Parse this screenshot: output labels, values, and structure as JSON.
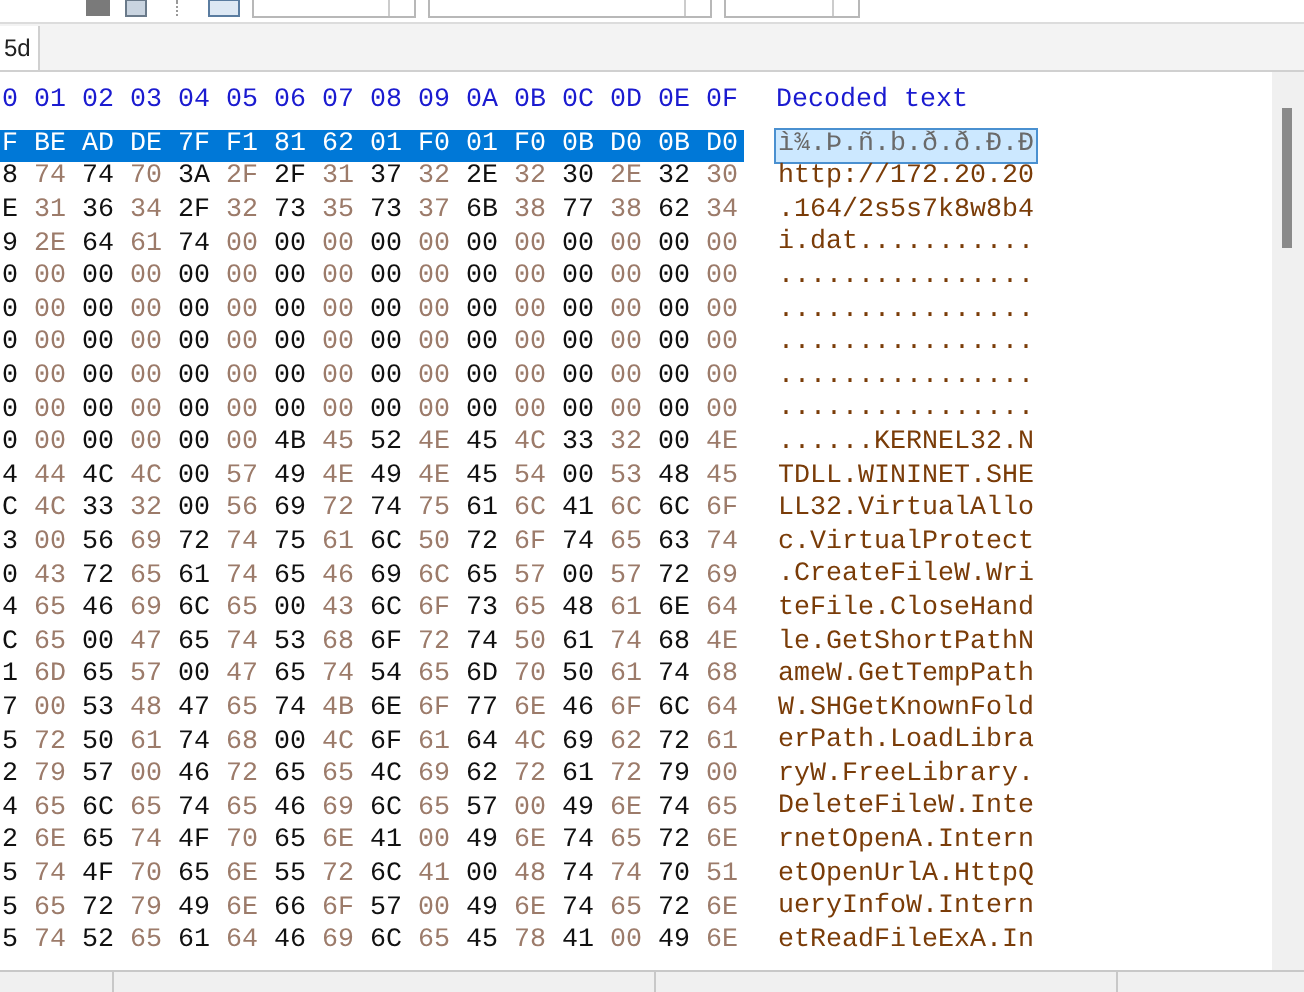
{
  "tabs": [
    {
      "label": "5d",
      "selected": true
    }
  ],
  "hex_header": {
    "offsets": [
      "0",
      "01",
      "02",
      "03",
      "04",
      "05",
      "06",
      "07",
      "08",
      "09",
      "0A",
      "0B",
      "0C",
      "0D",
      "0E",
      "0F"
    ],
    "decoded_label": "Decoded text"
  },
  "rows": [
    {
      "bytes": [
        "F",
        "BE",
        "AD",
        "DE",
        "7F",
        "F1",
        "81",
        "62",
        "01",
        "F0",
        "01",
        "F0",
        "0B",
        "D0",
        "0B",
        "D0"
      ],
      "decoded": "ì¾.Þ.ñ.b.ð.ð.Ð.Ð",
      "selected": true
    },
    {
      "bytes": [
        "8",
        "74",
        "74",
        "70",
        "3A",
        "2F",
        "2F",
        "31",
        "37",
        "32",
        "2E",
        "32",
        "30",
        "2E",
        "32",
        "30"
      ],
      "decoded": "http://172.20.20",
      "selected": false
    },
    {
      "bytes": [
        "E",
        "31",
        "36",
        "34",
        "2F",
        "32",
        "73",
        "35",
        "73",
        "37",
        "6B",
        "38",
        "77",
        "38",
        "62",
        "34"
      ],
      "decoded": ".164/2s5s7k8w8b4",
      "selected": false
    },
    {
      "bytes": [
        "9",
        "2E",
        "64",
        "61",
        "74",
        "00",
        "00",
        "00",
        "00",
        "00",
        "00",
        "00",
        "00",
        "00",
        "00",
        "00"
      ],
      "decoded": "i.dat...........",
      "selected": false
    },
    {
      "bytes": [
        "0",
        "00",
        "00",
        "00",
        "00",
        "00",
        "00",
        "00",
        "00",
        "00",
        "00",
        "00",
        "00",
        "00",
        "00",
        "00"
      ],
      "decoded": "................",
      "selected": false
    },
    {
      "bytes": [
        "0",
        "00",
        "00",
        "00",
        "00",
        "00",
        "00",
        "00",
        "00",
        "00",
        "00",
        "00",
        "00",
        "00",
        "00",
        "00"
      ],
      "decoded": "................",
      "selected": false
    },
    {
      "bytes": [
        "0",
        "00",
        "00",
        "00",
        "00",
        "00",
        "00",
        "00",
        "00",
        "00",
        "00",
        "00",
        "00",
        "00",
        "00",
        "00"
      ],
      "decoded": "................",
      "selected": false
    },
    {
      "bytes": [
        "0",
        "00",
        "00",
        "00",
        "00",
        "00",
        "00",
        "00",
        "00",
        "00",
        "00",
        "00",
        "00",
        "00",
        "00",
        "00"
      ],
      "decoded": "................",
      "selected": false
    },
    {
      "bytes": [
        "0",
        "00",
        "00",
        "00",
        "00",
        "00",
        "00",
        "00",
        "00",
        "00",
        "00",
        "00",
        "00",
        "00",
        "00",
        "00"
      ],
      "decoded": "................",
      "selected": false
    },
    {
      "bytes": [
        "0",
        "00",
        "00",
        "00",
        "00",
        "00",
        "4B",
        "45",
        "52",
        "4E",
        "45",
        "4C",
        "33",
        "32",
        "00",
        "4E"
      ],
      "decoded": "......KERNEL32.N",
      "selected": false
    },
    {
      "bytes": [
        "4",
        "44",
        "4C",
        "4C",
        "00",
        "57",
        "49",
        "4E",
        "49",
        "4E",
        "45",
        "54",
        "00",
        "53",
        "48",
        "45"
      ],
      "decoded": "TDLL.WININET.SHE",
      "selected": false
    },
    {
      "bytes": [
        "C",
        "4C",
        "33",
        "32",
        "00",
        "56",
        "69",
        "72",
        "74",
        "75",
        "61",
        "6C",
        "41",
        "6C",
        "6C",
        "6F"
      ],
      "decoded": "LL32.VirtualAllo",
      "selected": false
    },
    {
      "bytes": [
        "3",
        "00",
        "56",
        "69",
        "72",
        "74",
        "75",
        "61",
        "6C",
        "50",
        "72",
        "6F",
        "74",
        "65",
        "63",
        "74"
      ],
      "decoded": "c.VirtualProtect",
      "selected": false
    },
    {
      "bytes": [
        "0",
        "43",
        "72",
        "65",
        "61",
        "74",
        "65",
        "46",
        "69",
        "6C",
        "65",
        "57",
        "00",
        "57",
        "72",
        "69"
      ],
      "decoded": ".CreateFileW.Wri",
      "selected": false
    },
    {
      "bytes": [
        "4",
        "65",
        "46",
        "69",
        "6C",
        "65",
        "00",
        "43",
        "6C",
        "6F",
        "73",
        "65",
        "48",
        "61",
        "6E",
        "64"
      ],
      "decoded": "teFile.CloseHand",
      "selected": false
    },
    {
      "bytes": [
        "C",
        "65",
        "00",
        "47",
        "65",
        "74",
        "53",
        "68",
        "6F",
        "72",
        "74",
        "50",
        "61",
        "74",
        "68",
        "4E"
      ],
      "decoded": "le.GetShortPathN",
      "selected": false
    },
    {
      "bytes": [
        "1",
        "6D",
        "65",
        "57",
        "00",
        "47",
        "65",
        "74",
        "54",
        "65",
        "6D",
        "70",
        "50",
        "61",
        "74",
        "68"
      ],
      "decoded": "ameW.GetTempPath",
      "selected": false
    },
    {
      "bytes": [
        "7",
        "00",
        "53",
        "48",
        "47",
        "65",
        "74",
        "4B",
        "6E",
        "6F",
        "77",
        "6E",
        "46",
        "6F",
        "6C",
        "64"
      ],
      "decoded": "W.SHGetKnownFold",
      "selected": false
    },
    {
      "bytes": [
        "5",
        "72",
        "50",
        "61",
        "74",
        "68",
        "00",
        "4C",
        "6F",
        "61",
        "64",
        "4C",
        "69",
        "62",
        "72",
        "61"
      ],
      "decoded": "erPath.LoadLibra",
      "selected": false
    },
    {
      "bytes": [
        "2",
        "79",
        "57",
        "00",
        "46",
        "72",
        "65",
        "65",
        "4C",
        "69",
        "62",
        "72",
        "61",
        "72",
        "79",
        "00"
      ],
      "decoded": "ryW.FreeLibrary.",
      "selected": false
    },
    {
      "bytes": [
        "4",
        "65",
        "6C",
        "65",
        "74",
        "65",
        "46",
        "69",
        "6C",
        "65",
        "57",
        "00",
        "49",
        "6E",
        "74",
        "65"
      ],
      "decoded": "DeleteFileW.Inte",
      "selected": false
    },
    {
      "bytes": [
        "2",
        "6E",
        "65",
        "74",
        "4F",
        "70",
        "65",
        "6E",
        "41",
        "00",
        "49",
        "6E",
        "74",
        "65",
        "72",
        "6E"
      ],
      "decoded": "rnetOpenA.Intern",
      "selected": false
    },
    {
      "bytes": [
        "5",
        "74",
        "4F",
        "70",
        "65",
        "6E",
        "55",
        "72",
        "6C",
        "41",
        "00",
        "48",
        "74",
        "74",
        "70",
        "51"
      ],
      "decoded": "etOpenUrlA.HttpQ",
      "selected": false
    },
    {
      "bytes": [
        "5",
        "65",
        "72",
        "79",
        "49",
        "6E",
        "66",
        "6F",
        "57",
        "00",
        "49",
        "6E",
        "74",
        "65",
        "72",
        "6E"
      ],
      "decoded": "ueryInfoW.Intern",
      "selected": false
    },
    {
      "bytes": [
        "5",
        "74",
        "52",
        "65",
        "61",
        "64",
        "46",
        "69",
        "6C",
        "65",
        "45",
        "78",
        "41",
        "00",
        "49",
        "6E"
      ],
      "decoded": "etReadFileExA.In",
      "selected": false
    }
  ]
}
